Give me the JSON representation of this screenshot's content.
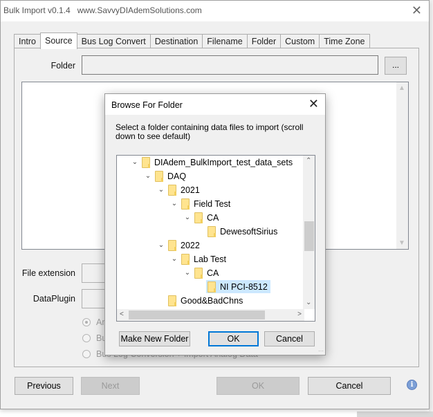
{
  "window": {
    "title": "Bulk Import v0.1.4   www.SavvyDIAdemSolutions.com",
    "close_glyph": "✕"
  },
  "tabs": [
    {
      "label": "Intro",
      "active": false
    },
    {
      "label": "Source",
      "active": true
    },
    {
      "label": "Bus Log Convert",
      "active": false
    },
    {
      "label": "Destination",
      "active": false
    },
    {
      "label": "Filename",
      "active": false
    },
    {
      "label": "Folder",
      "active": false
    },
    {
      "label": "Custom",
      "active": false
    },
    {
      "label": "Time Zone",
      "active": false
    }
  ],
  "source": {
    "folder_label": "Folder",
    "folder_value": "",
    "browse_label": "...",
    "file_extension_label": "File extension",
    "file_extension_value": "",
    "dataplugin_label": "DataPlugin",
    "dataplugin_value": "",
    "radio_options": [
      {
        "label": "Analog Data",
        "checked": true,
        "visible_text": "An"
      },
      {
        "label": "Bus Log Conversion",
        "checked": false,
        "visible_text": "Bus"
      },
      {
        "label": "Bus Log Conversion + Import Analog Data",
        "checked": false,
        "visible_text": "Bus Log Conversion + Import Analog Data"
      }
    ]
  },
  "footer": {
    "previous_label": "Previous",
    "next_label": "Next",
    "ok_label": "OK",
    "cancel_label": "Cancel",
    "info_glyph": "i"
  },
  "dialog": {
    "title": "Browse For Folder",
    "close_glyph": "✕",
    "description": "Select a folder containing data files to import (scroll down to see default)",
    "tree": [
      {
        "label": "DIAdem_BulkImport_test_data_sets",
        "level": 0,
        "expanded": true,
        "selected": false
      },
      {
        "label": "DAQ",
        "level": 1,
        "expanded": true,
        "selected": false
      },
      {
        "label": "2021",
        "level": 2,
        "expanded": true,
        "selected": false
      },
      {
        "label": "Field Test",
        "level": 3,
        "expanded": true,
        "selected": false
      },
      {
        "label": "CA",
        "level": 4,
        "expanded": true,
        "selected": false
      },
      {
        "label": "DewesoftSirius",
        "level": 5,
        "expanded": null,
        "selected": false
      },
      {
        "label": "2022",
        "level": 2,
        "expanded": true,
        "selected": false
      },
      {
        "label": "Lab Test",
        "level": 3,
        "expanded": true,
        "selected": false
      },
      {
        "label": "CA",
        "level": 4,
        "expanded": true,
        "selected": false
      },
      {
        "label": "NI PCI-8512",
        "level": 5,
        "expanded": null,
        "selected": true
      },
      {
        "label": "Good&BadChns",
        "level": 2,
        "expanded": null,
        "selected": false
      }
    ],
    "make_new_folder_label": "Make New Folder",
    "ok_label": "OK",
    "cancel_label": "Cancel"
  }
}
